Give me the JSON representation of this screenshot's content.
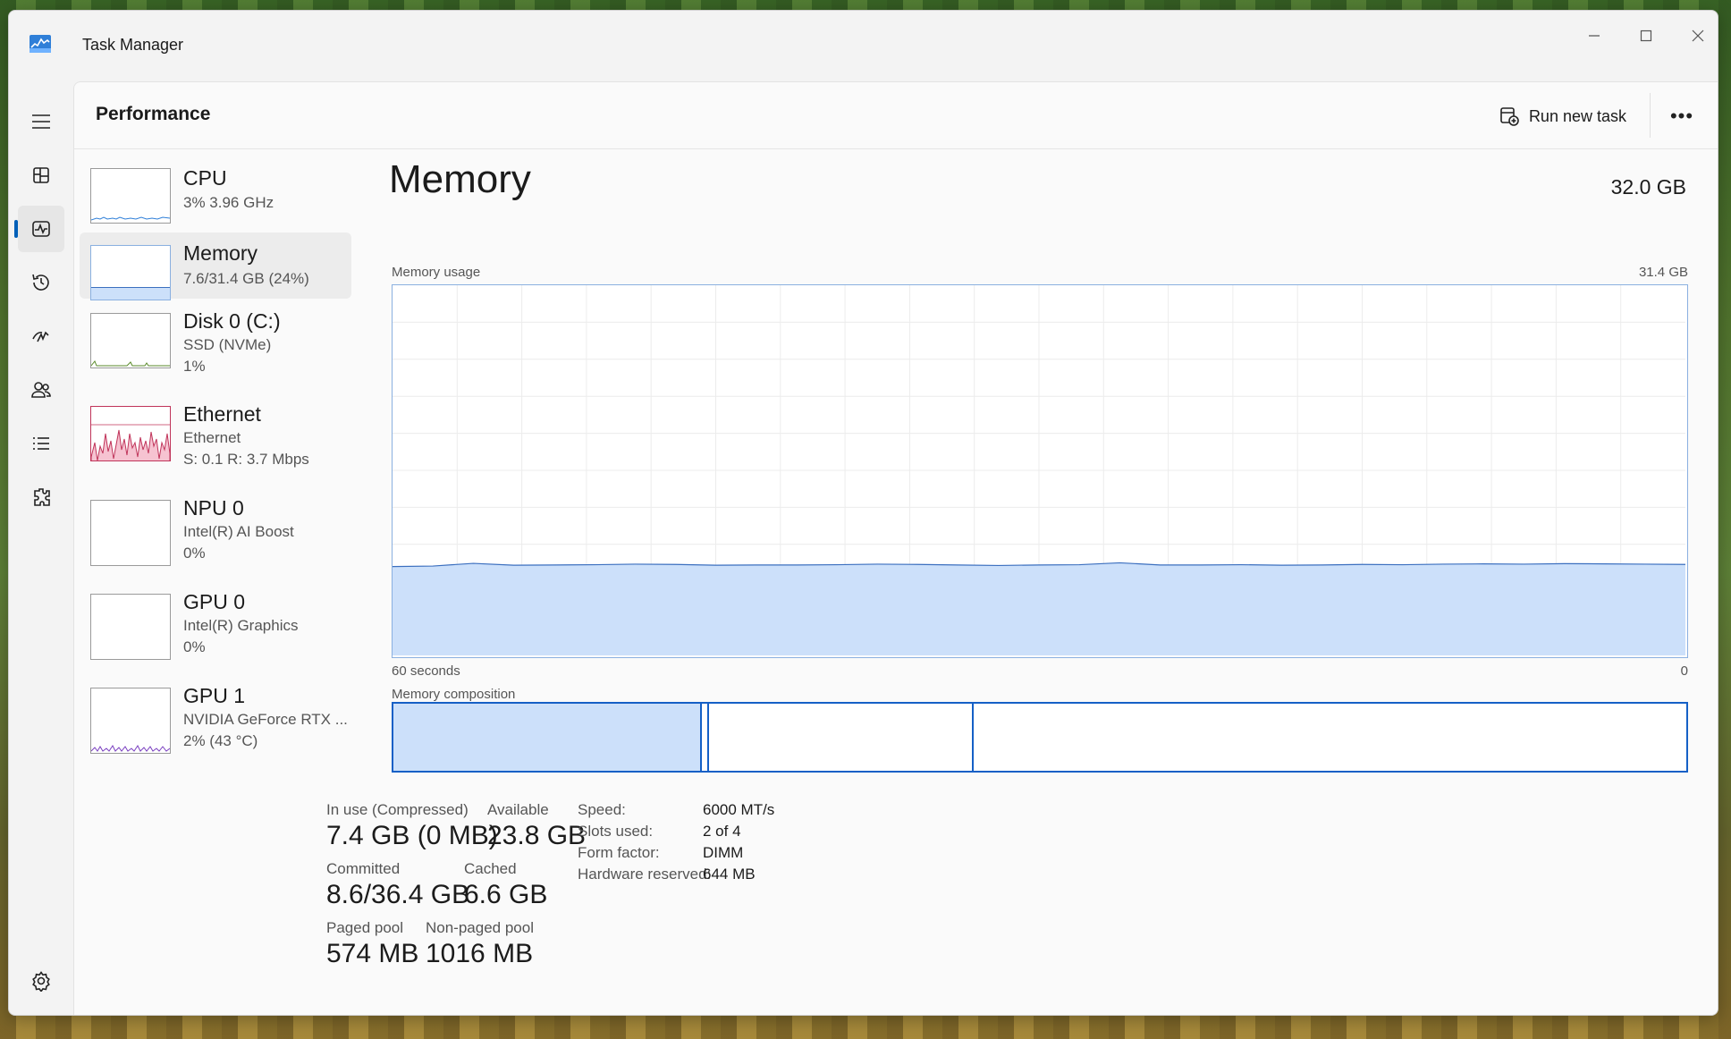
{
  "window": {
    "title": "Task Manager"
  },
  "header": {
    "title": "Performance",
    "run_task_label": "Run new task",
    "more_label": "•••"
  },
  "nav": [
    "Processes",
    "Performance",
    "App history",
    "Startup apps",
    "Users",
    "Details",
    "Services",
    "Settings"
  ],
  "devices": [
    {
      "name": "CPU",
      "sub1": "3%  3.96 GHz",
      "sub2": ""
    },
    {
      "name": "Memory",
      "sub1": "7.6/31.4 GB (24%)",
      "sub2": ""
    },
    {
      "name": "Disk 0 (C:)",
      "sub1": "SSD (NVMe)",
      "sub2": "1%"
    },
    {
      "name": "Ethernet",
      "sub1": "Ethernet",
      "sub2": "S: 0.1  R: 3.7 Mbps"
    },
    {
      "name": "NPU 0",
      "sub1": "Intel(R) AI Boost",
      "sub2": "0%"
    },
    {
      "name": "GPU 0",
      "sub1": "Intel(R) Graphics",
      "sub2": "0%"
    },
    {
      "name": "GPU 1",
      "sub1": "NVIDIA GeForce RTX ...",
      "sub2": "2%  (43 °C)"
    }
  ],
  "memory": {
    "title": "Memory",
    "total": "32.0 GB",
    "usage_label": "Memory usage",
    "usage_max": "31.4 GB",
    "time_left": "60 seconds",
    "time_right": "0",
    "composition_label": "Memory composition",
    "usage_fraction": 0.24,
    "stats": {
      "in_use_label": "In use (Compressed)",
      "in_use": "7.4 GB (0 MB)",
      "available_label": "Available",
      "available": "23.8 GB",
      "committed_label": "Committed",
      "committed": "8.6/36.4 GB",
      "cached_label": "Cached",
      "cached": "6.6 GB",
      "paged_label": "Paged pool",
      "paged": "574 MB",
      "nonpaged_label": "Non-paged pool",
      "nonpaged": "1016 MB"
    },
    "specs": {
      "speed_label": "Speed:",
      "speed": "6000 MT/s",
      "slots_label": "Slots used:",
      "slots": "2 of 4",
      "form_label": "Form factor:",
      "form": "DIMM",
      "reserved_label": "Hardware reserved:",
      "reserved": "644 MB"
    }
  },
  "colors": {
    "accent": "#005fb8",
    "memory_line": "#3b6fbf",
    "memory_fill": "#cce0fa",
    "ethernet": "#c0345a"
  }
}
